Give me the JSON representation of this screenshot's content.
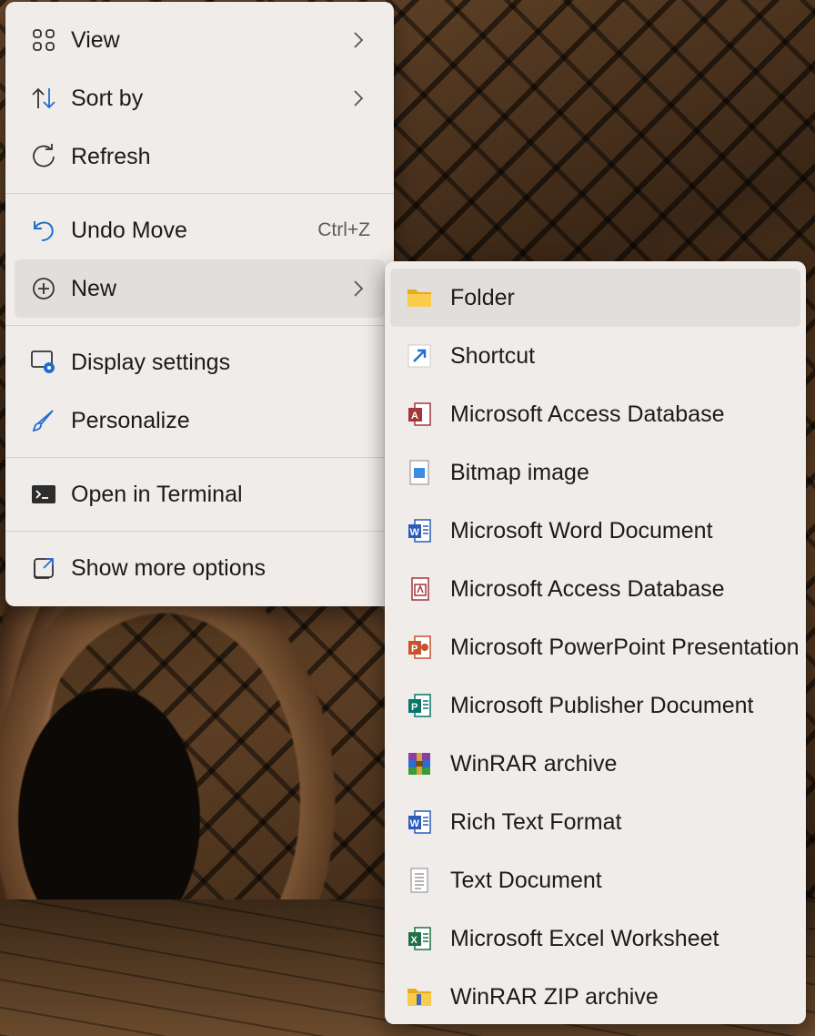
{
  "main_menu": {
    "items": [
      {
        "label": "View",
        "icon": "view-grid-icon",
        "submenu": true
      },
      {
        "label": "Sort by",
        "icon": "sort-arrows-icon",
        "submenu": true
      },
      {
        "label": "Refresh",
        "icon": "refresh-icon"
      },
      {
        "label": "Undo Move",
        "icon": "undo-icon",
        "shortcut": "Ctrl+Z"
      },
      {
        "label": "New",
        "icon": "plus-circle-icon",
        "submenu": true,
        "highlighted": true
      },
      {
        "label": "Display settings",
        "icon": "display-settings-icon"
      },
      {
        "label": "Personalize",
        "icon": "brush-icon"
      },
      {
        "label": "Open in Terminal",
        "icon": "terminal-icon"
      },
      {
        "label": "Show more options",
        "icon": "expand-icon"
      }
    ]
  },
  "new_submenu": {
    "items": [
      {
        "label": "Folder",
        "icon": "folder-icon",
        "highlighted": true
      },
      {
        "label": "Shortcut",
        "icon": "shortcut-arrow-icon"
      },
      {
        "label": "Microsoft Access Database",
        "icon": "access-icon"
      },
      {
        "label": "Bitmap image",
        "icon": "bitmap-icon"
      },
      {
        "label": "Microsoft Word Document",
        "icon": "word-icon"
      },
      {
        "label": "Microsoft Access Database",
        "icon": "access-icon"
      },
      {
        "label": "Microsoft PowerPoint Presentation",
        "icon": "powerpoint-icon"
      },
      {
        "label": "Microsoft Publisher Document",
        "icon": "publisher-icon"
      },
      {
        "label": "WinRAR archive",
        "icon": "winrar-icon"
      },
      {
        "label": "Rich Text Format",
        "icon": "word-icon"
      },
      {
        "label": "Text Document",
        "icon": "text-document-icon"
      },
      {
        "label": "Microsoft Excel Worksheet",
        "icon": "excel-icon"
      },
      {
        "label": "WinRAR ZIP archive",
        "icon": "zip-icon"
      }
    ]
  },
  "colors": {
    "menu_bg": "#f0ecea",
    "highlight": "#e2dedc",
    "accent_blue": "#1f6fd1",
    "folder_yellow": "#f4c542",
    "word_blue": "#2b5cb8",
    "access_red": "#a4373a",
    "powerpoint_orange": "#c8512e",
    "publisher_teal": "#077568",
    "excel_green": "#1e7145"
  }
}
